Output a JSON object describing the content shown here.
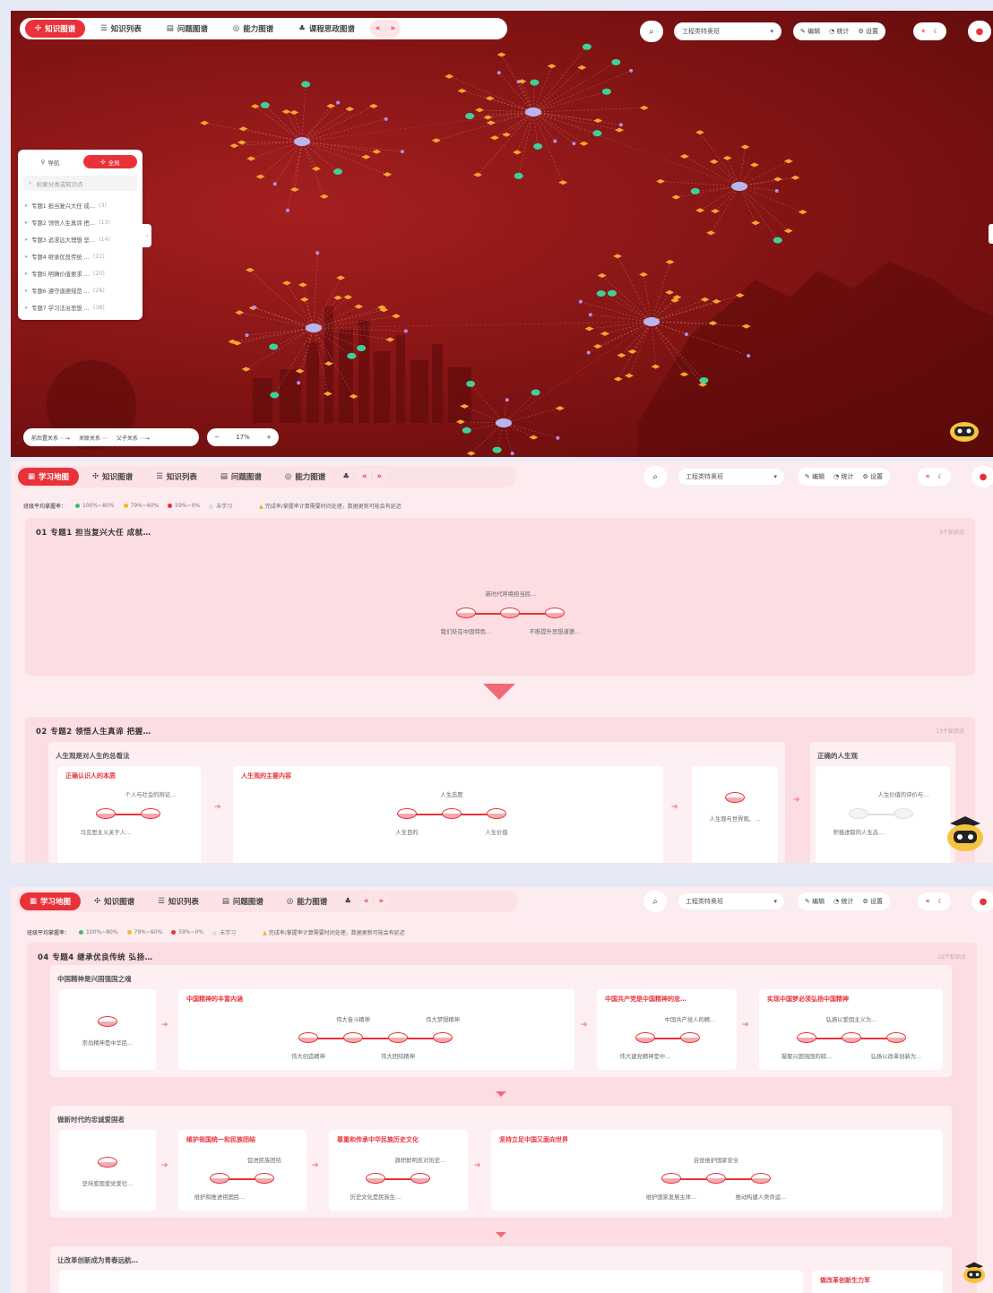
{
  "graph_view": {
    "tabs": [
      {
        "label": "知识图谱",
        "active": true
      },
      {
        "label": "知识列表"
      },
      {
        "label": "问题图谱"
      },
      {
        "label": "能力图谱"
      },
      {
        "label": "课程思政图谱"
      }
    ],
    "class_select": "工程类特奥班",
    "tools": [
      "编辑",
      "统计",
      "设置"
    ],
    "sidebar": {
      "tab_nav": "导航",
      "tab_all": "全局",
      "search_placeholder": "检索分类或知识点",
      "items": [
        {
          "label": "专题1 担当复兴大任 成…",
          "count": "(3)"
        },
        {
          "label": "专题2 领悟人生真谛 把…",
          "count": "(13)"
        },
        {
          "label": "专题3 追求远大理想 坚…",
          "count": "(14)"
        },
        {
          "label": "专题4 继承优良传统 …",
          "count": "(22)"
        },
        {
          "label": "专题5 明确价值要求 …",
          "count": "(20)"
        },
        {
          "label": "专题6 遵守道德规范 …",
          "count": "(28)"
        },
        {
          "label": "专题7 学习法治思想 …",
          "count": "(38)"
        }
      ]
    },
    "legend": [
      "前后置关系",
      "关联关系",
      "父子关系"
    ],
    "zoom": "17%"
  },
  "map_view1": {
    "tabs": [
      {
        "label": "学习地图",
        "active": true
      },
      {
        "label": "知识图谱"
      },
      {
        "label": "知识列表"
      },
      {
        "label": "问题图谱"
      },
      {
        "label": "能力图谱"
      }
    ],
    "class_select": "工程类特奥班",
    "tools": [
      "编辑",
      "统计",
      "设置"
    ],
    "mastery_label": "班级平均掌握率：",
    "mastery_levels": [
      "100%~80%",
      "79%~60%",
      "59%~0%",
      "未学习"
    ],
    "notice": "完成率/掌握率计算需要时间处理，数据更新可能会有延迟",
    "topic1": {
      "title": "01 专题1 担当复兴大任 成就…",
      "count": "3个知识点",
      "nodes": [
        "新时代呼唤担当民…",
        "我们处在中国特色…",
        "不断提升思想道德…"
      ]
    },
    "topic2": {
      "title": "02 专题2 领悟人生真谛 把握…",
      "count": "13个知识点",
      "panel1": {
        "title": "人生观是对人生的总看法",
        "box1": {
          "title": "正确认识人的本质",
          "nodes": [
            "个人与社会的辩证…",
            "马克思主义关于人…"
          ]
        },
        "box2": {
          "title": "人生观的主要内容",
          "nodes": [
            "人生态度",
            "人生目的",
            "人生价值"
          ]
        },
        "box3": {
          "nodes": [
            "人生观与世界观、…"
          ]
        }
      },
      "panel2": {
        "title": "正确的人生观",
        "nodes": [
          "人生价值的评价与…",
          "积极进取的人生态…"
        ]
      }
    }
  },
  "map_view2": {
    "tabs": [
      {
        "label": "学习地图",
        "active": true
      },
      {
        "label": "知识图谱"
      },
      {
        "label": "知识列表"
      },
      {
        "label": "问题图谱"
      },
      {
        "label": "能力图谱"
      }
    ],
    "class_select": "工程类特奥班",
    "tools": [
      "编辑",
      "统计",
      "设置"
    ],
    "mastery_label": "班级平均掌握率：",
    "mastery_levels": [
      "100%~80%",
      "79%~60%",
      "59%~0%",
      "未学习"
    ],
    "notice": "完成率/掌握率计算需要时间处理，数据更新可能会有延迟",
    "topic4": {
      "title": "04 专题4 继承优良传统 弘扬…",
      "count": "22个知识点",
      "panel1": {
        "title": "中国精神是兴国强国之魂",
        "box0": {
          "nodes": [
            "崇尚精神是中华民…"
          ]
        },
        "box1": {
          "title": "中国精神的丰富内涵",
          "nodes": [
            "伟大奋斗精神",
            "伟大梦想精神",
            "伟大创造精神",
            "伟大团结精神"
          ]
        },
        "box2": {
          "title": "中国共产党是中国精神的忠…",
          "nodes": [
            "中国共产党人的精…",
            "伟大建党精神是中…"
          ]
        },
        "box3": {
          "title": "实现中国梦必须弘扬中国精神",
          "nodes": [
            "弘扬以爱国主义为…",
            "凝聚兴国强国的磅…",
            "弘扬以改革创新为…"
          ]
        }
      },
      "panel2": {
        "title": "做新时代的忠诚爱国者",
        "box0": {
          "nodes": [
            "坚持爱国爱党爱社…"
          ]
        },
        "box1": {
          "title": "维护祖国统一和民族团结",
          "nodes": [
            "促进民族团结",
            "维护和推进祖国民…"
          ]
        },
        "box2": {
          "title": "尊重和传承中华民族历史文化",
          "nodes": [
            "旗帜鲜明反对历史…",
            "历史文化是民族生…"
          ]
        },
        "box3": {
          "title": "坚持立足中国又面向世界",
          "nodes": [
            "自觉维护国家安全",
            "维护国家发展主体…",
            "推动构建人类命运…"
          ]
        }
      },
      "panel3": {
        "title": "让改革创新成为青春远航…",
        "box_title": "做改革创新生力军"
      }
    }
  },
  "colors": {
    "accent": "#e8323a",
    "bg_red": "#8b1515",
    "card_pink": "#fbdde2",
    "mastery": [
      "#3dbf6a",
      "#f5b731",
      "#e8323a",
      "#dddddd"
    ]
  }
}
